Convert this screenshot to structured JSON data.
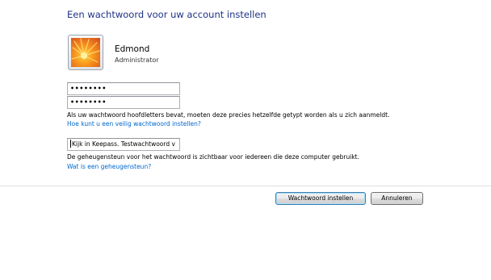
{
  "page": {
    "title": "Een wachtwoord voor uw account instellen"
  },
  "user": {
    "name": "Edmond",
    "role": "Administrator"
  },
  "password": {
    "new_value": "••••••••",
    "confirm_value": "••••••••"
  },
  "case_info": "Als uw wachtwoord hoofdletters bevat, moeten deze precies hetzelfde getypt worden als u zich aanmeldt.",
  "secure_password_link": "Hoe kunt u een veilig wachtwoord instellen?",
  "hint": {
    "value": "Kijk in Keepass. Testwachtwoord v",
    "info": "De geheugensteun voor het wachtwoord is zichtbaar voor iedereen die deze computer gebruikt.",
    "link": "Wat is een geheugensteun?"
  },
  "buttons": {
    "set_password": "Wachtwoord instellen",
    "cancel": "Annuleren"
  },
  "colors": {
    "title": "#1e3287",
    "link": "#0066cc",
    "divider": "#dfdfdf"
  },
  "icons": {
    "avatar": "orange-flower-picture"
  }
}
